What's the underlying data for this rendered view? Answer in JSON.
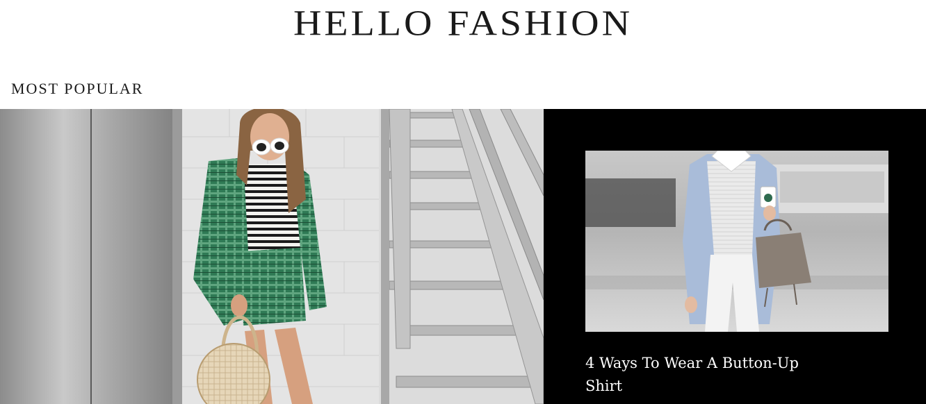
{
  "site": {
    "title": "HELLO FASHION"
  },
  "most_popular": {
    "heading": "MOST POPULAR",
    "side_article": {
      "title": "4 Ways To Wear A Button-Up Shirt"
    }
  },
  "colors": {
    "page_background": "#ffffff",
    "card_background": "#000000",
    "title_text": "#1a1a1a",
    "card_text": "#ffffff"
  },
  "icons": {
    "video_overlay": "play-icon"
  }
}
